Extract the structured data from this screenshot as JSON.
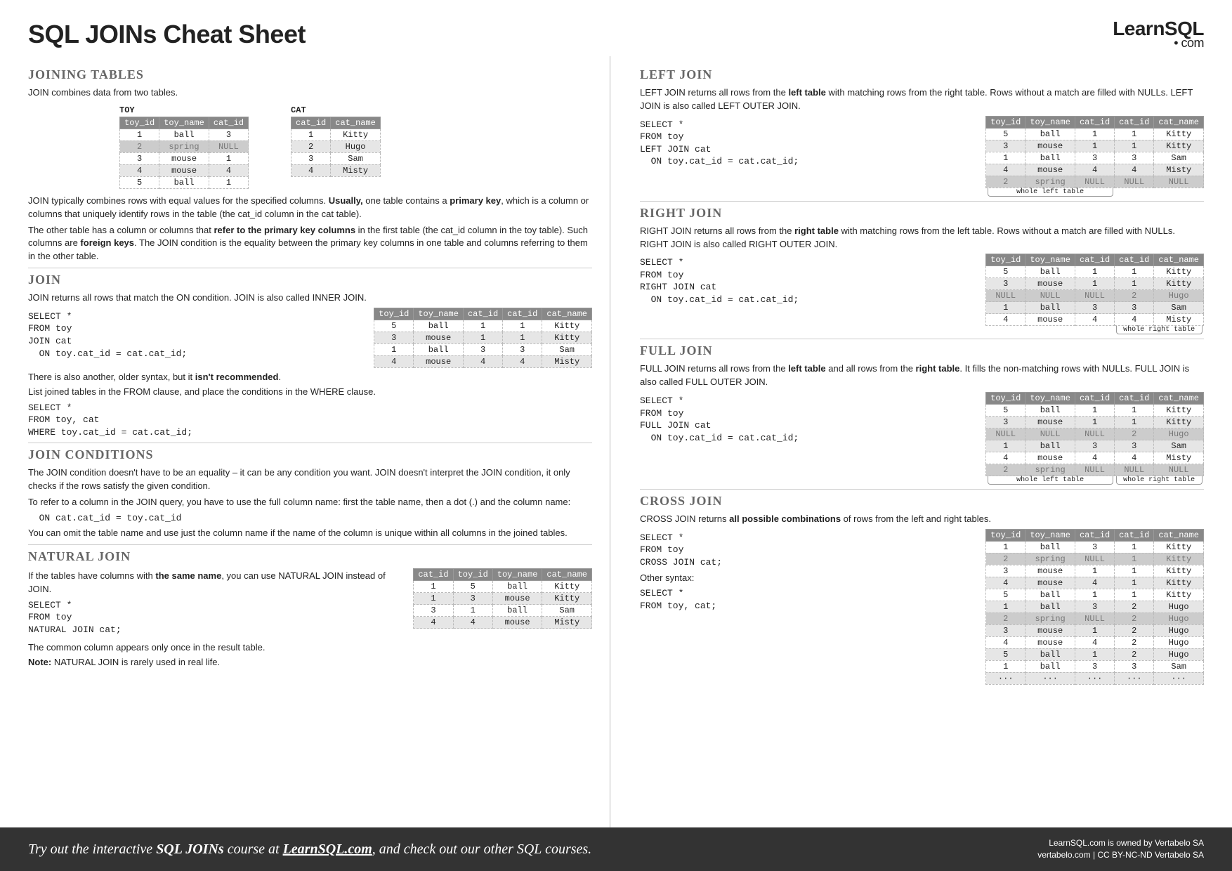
{
  "title": "SQL JOINs Cheat Sheet",
  "logo": {
    "main": "LearnSQL",
    "sub": "• com"
  },
  "s1": {
    "h": "JOINING TABLES",
    "p1": "JOIN combines data from two tables.",
    "toy_label": "TOY",
    "cat_label": "CAT",
    "toy_headers": [
      "toy_id",
      "toy_name",
      "cat_id"
    ],
    "toy_rows": [
      [
        "1",
        "ball",
        "3"
      ],
      [
        "2",
        "spring",
        "NULL"
      ],
      [
        "3",
        "mouse",
        "1"
      ],
      [
        "4",
        "mouse",
        "4"
      ],
      [
        "5",
        "ball",
        "1"
      ]
    ],
    "cat_headers": [
      "cat_id",
      "cat_name"
    ],
    "cat_rows": [
      [
        "1",
        "Kitty"
      ],
      [
        "2",
        "Hugo"
      ],
      [
        "3",
        "Sam"
      ],
      [
        "4",
        "Misty"
      ]
    ],
    "p2a": "JOIN typically combines rows with equal values for the specified columns. ",
    "p2b": "Usually,",
    "p2c": " one table contains a ",
    "p2d": "primary key",
    "p2e": ", which is a column or columns that uniquely identify rows in the table (the cat_id column in the cat table).",
    "p3a": "The other table has a column or columns that ",
    "p3b": "refer to the primary key columns",
    "p3c": " in the first table (the cat_id column in the toy table). Such columns are ",
    "p3d": "foreign keys",
    "p3e": ". The JOIN condition is the equality between the primary key columns in one table and columns referring to them in the other table."
  },
  "s2": {
    "h": "JOIN",
    "p1": "JOIN returns all rows that match the ON condition. JOIN is also called INNER JOIN.",
    "code1": "SELECT *\nFROM toy\nJOIN cat\n  ON toy.cat_id = cat.cat_id;",
    "headers": [
      "toy_id",
      "toy_name",
      "cat_id",
      "cat_id",
      "cat_name"
    ],
    "rows": [
      [
        "5",
        "ball",
        "1",
        "1",
        "Kitty"
      ],
      [
        "3",
        "mouse",
        "1",
        "1",
        "Kitty"
      ],
      [
        "1",
        "ball",
        "3",
        "3",
        "Sam"
      ],
      [
        "4",
        "mouse",
        "4",
        "4",
        "Misty"
      ]
    ],
    "p2a": "There is also another, older syntax, but it ",
    "p2b": "isn't recommended",
    "p2c": ".",
    "p3": "List joined tables in the FROM clause, and place the conditions in the WHERE clause.",
    "code2": "SELECT *\nFROM toy, cat\nWHERE toy.cat_id = cat.cat_id;"
  },
  "s3": {
    "h": "JOIN CONDITIONS",
    "p1": "The JOIN condition doesn't have to be an equality – it can be any condition you want. JOIN doesn't interpret the JOIN condition, it only checks if the rows satisfy the given condition.",
    "p2": "To refer to a column in the JOIN query, you have to use the full column name: first the table name, then a dot (.) and the column name:",
    "code": "  ON cat.cat_id = toy.cat_id",
    "p3": "You can omit the table name and use just the column name if the name of the column is unique within all columns in the joined tables."
  },
  "s4": {
    "h": "NATURAL JOIN",
    "p1a": "If the tables have columns with ",
    "p1b": "the same name",
    "p1c": ", you can use NATURAL JOIN instead of JOIN.",
    "code": "SELECT *\nFROM toy\nNATURAL JOIN cat;",
    "headers": [
      "cat_id",
      "toy_id",
      "toy_name",
      "cat_name"
    ],
    "rows": [
      [
        "1",
        "5",
        "ball",
        "Kitty"
      ],
      [
        "1",
        "3",
        "mouse",
        "Kitty"
      ],
      [
        "3",
        "1",
        "ball",
        "Sam"
      ],
      [
        "4",
        "4",
        "mouse",
        "Misty"
      ]
    ],
    "p2": "The common column appears only once in the result table.",
    "p3a": "Note: ",
    "p3b": "NATURAL JOIN is rarely used in real life."
  },
  "s5": {
    "h": "LEFT JOIN",
    "p1a": "LEFT JOIN returns all rows from the ",
    "p1b": "left table",
    "p1c": " with matching rows from the right table. Rows without a match are filled with NULLs. LEFT JOIN is also called LEFT OUTER JOIN.",
    "code": "SELECT *\nFROM toy\nLEFT JOIN cat\n  ON toy.cat_id = cat.cat_id;",
    "headers": [
      "toy_id",
      "toy_name",
      "cat_id",
      "cat_id",
      "cat_name"
    ],
    "rows": [
      [
        "5",
        "ball",
        "1",
        "1",
        "Kitty"
      ],
      [
        "3",
        "mouse",
        "1",
        "1",
        "Kitty"
      ],
      [
        "1",
        "ball",
        "3",
        "3",
        "Sam"
      ],
      [
        "4",
        "mouse",
        "4",
        "4",
        "Misty"
      ],
      [
        "2",
        "spring",
        "NULL",
        "NULL",
        "NULL"
      ]
    ],
    "note": "whole left table"
  },
  "s6": {
    "h": "RIGHT JOIN",
    "p1a": "RIGHT JOIN returns all rows from the ",
    "p1b": "right table",
    "p1c": " with matching rows from the left table. Rows without a match are filled with NULLs. RIGHT JOIN is also called RIGHT OUTER JOIN.",
    "code": "SELECT *\nFROM toy\nRIGHT JOIN cat\n  ON toy.cat_id = cat.cat_id;",
    "headers": [
      "toy_id",
      "toy_name",
      "cat_id",
      "cat_id",
      "cat_name"
    ],
    "rows": [
      [
        "5",
        "ball",
        "1",
        "1",
        "Kitty"
      ],
      [
        "3",
        "mouse",
        "1",
        "1",
        "Kitty"
      ],
      [
        "NULL",
        "NULL",
        "NULL",
        "2",
        "Hugo"
      ],
      [
        "1",
        "ball",
        "3",
        "3",
        "Sam"
      ],
      [
        "4",
        "mouse",
        "4",
        "4",
        "Misty"
      ]
    ],
    "note": "whole right table"
  },
  "s7": {
    "h": "FULL JOIN",
    "p1a": "FULL JOIN returns all rows from the ",
    "p1b": "left table",
    "p1c": " and all rows from the ",
    "p1d": "right table",
    "p1e": ". It fills the non-matching rows with NULLs. FULL JOIN is also called FULL OUTER JOIN.",
    "code": "SELECT *\nFROM toy\nFULL JOIN cat\n  ON toy.cat_id = cat.cat_id;",
    "headers": [
      "toy_id",
      "toy_name",
      "cat_id",
      "cat_id",
      "cat_name"
    ],
    "rows": [
      [
        "5",
        "ball",
        "1",
        "1",
        "Kitty"
      ],
      [
        "3",
        "mouse",
        "1",
        "1",
        "Kitty"
      ],
      [
        "NULL",
        "NULL",
        "NULL",
        "2",
        "Hugo"
      ],
      [
        "1",
        "ball",
        "3",
        "3",
        "Sam"
      ],
      [
        "4",
        "mouse",
        "4",
        "4",
        "Misty"
      ],
      [
        "2",
        "spring",
        "NULL",
        "NULL",
        "NULL"
      ]
    ],
    "note1": "whole left table",
    "note2": "whole right table"
  },
  "s8": {
    "h": "CROSS JOIN",
    "p1a": "CROSS JOIN returns ",
    "p1b": "all possible combinations",
    "p1c": " of rows from the left and right tables.",
    "code1": "SELECT *\nFROM toy\nCROSS JOIN cat;",
    "other": "Other syntax:",
    "code2": "SELECT *\nFROM toy, cat;",
    "headers": [
      "toy_id",
      "toy_name",
      "cat_id",
      "cat_id",
      "cat_name"
    ],
    "rows": [
      [
        "1",
        "ball",
        "3",
        "1",
        "Kitty"
      ],
      [
        "2",
        "spring",
        "NULL",
        "1",
        "Kitty"
      ],
      [
        "3",
        "mouse",
        "1",
        "1",
        "Kitty"
      ],
      [
        "4",
        "mouse",
        "4",
        "1",
        "Kitty"
      ],
      [
        "5",
        "ball",
        "1",
        "1",
        "Kitty"
      ],
      [
        "1",
        "ball",
        "3",
        "2",
        "Hugo"
      ],
      [
        "2",
        "spring",
        "NULL",
        "2",
        "Hugo"
      ],
      [
        "3",
        "mouse",
        "1",
        "2",
        "Hugo"
      ],
      [
        "4",
        "mouse",
        "4",
        "2",
        "Hugo"
      ],
      [
        "5",
        "ball",
        "1",
        "2",
        "Hugo"
      ],
      [
        "1",
        "ball",
        "3",
        "3",
        "Sam"
      ],
      [
        "···",
        "···",
        "···",
        "···",
        "···"
      ]
    ]
  },
  "footer": {
    "left_a": "Try out the interactive ",
    "left_b": "SQL JOINs",
    "left_c": " course at ",
    "left_d": "LearnSQL.com",
    "left_e": ", and check out our other SQL courses.",
    "r1": "LearnSQL.com is owned by Vertabelo SA",
    "r2": "vertabelo.com | CC BY-NC-ND Vertabelo SA"
  }
}
